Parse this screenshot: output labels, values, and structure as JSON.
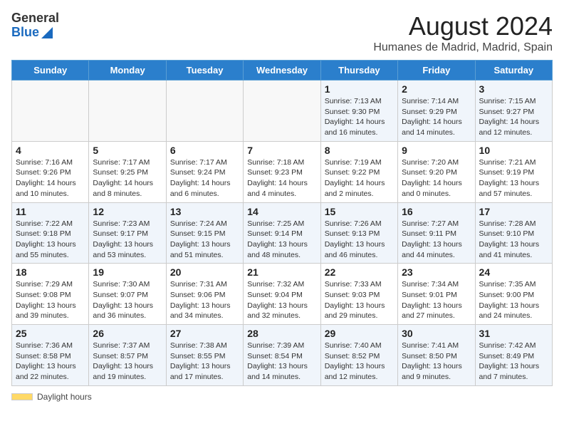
{
  "logo": {
    "general": "General",
    "blue": "Blue"
  },
  "title": "August 2024",
  "subtitle": "Humanes de Madrid, Madrid, Spain",
  "days_of_week": [
    "Sunday",
    "Monday",
    "Tuesday",
    "Wednesday",
    "Thursday",
    "Friday",
    "Saturday"
  ],
  "footer": {
    "label": "Daylight hours"
  },
  "weeks": [
    [
      {
        "day": "",
        "info": ""
      },
      {
        "day": "",
        "info": ""
      },
      {
        "day": "",
        "info": ""
      },
      {
        "day": "",
        "info": ""
      },
      {
        "day": "1",
        "info": "Sunrise: 7:13 AM\nSunset: 9:30 PM\nDaylight: 14 hours and 16 minutes."
      },
      {
        "day": "2",
        "info": "Sunrise: 7:14 AM\nSunset: 9:29 PM\nDaylight: 14 hours and 14 minutes."
      },
      {
        "day": "3",
        "info": "Sunrise: 7:15 AM\nSunset: 9:27 PM\nDaylight: 14 hours and 12 minutes."
      }
    ],
    [
      {
        "day": "4",
        "info": "Sunrise: 7:16 AM\nSunset: 9:26 PM\nDaylight: 14 hours and 10 minutes."
      },
      {
        "day": "5",
        "info": "Sunrise: 7:17 AM\nSunset: 9:25 PM\nDaylight: 14 hours and 8 minutes."
      },
      {
        "day": "6",
        "info": "Sunrise: 7:17 AM\nSunset: 9:24 PM\nDaylight: 14 hours and 6 minutes."
      },
      {
        "day": "7",
        "info": "Sunrise: 7:18 AM\nSunset: 9:23 PM\nDaylight: 14 hours and 4 minutes."
      },
      {
        "day": "8",
        "info": "Sunrise: 7:19 AM\nSunset: 9:22 PM\nDaylight: 14 hours and 2 minutes."
      },
      {
        "day": "9",
        "info": "Sunrise: 7:20 AM\nSunset: 9:20 PM\nDaylight: 14 hours and 0 minutes."
      },
      {
        "day": "10",
        "info": "Sunrise: 7:21 AM\nSunset: 9:19 PM\nDaylight: 13 hours and 57 minutes."
      }
    ],
    [
      {
        "day": "11",
        "info": "Sunrise: 7:22 AM\nSunset: 9:18 PM\nDaylight: 13 hours and 55 minutes."
      },
      {
        "day": "12",
        "info": "Sunrise: 7:23 AM\nSunset: 9:17 PM\nDaylight: 13 hours and 53 minutes."
      },
      {
        "day": "13",
        "info": "Sunrise: 7:24 AM\nSunset: 9:15 PM\nDaylight: 13 hours and 51 minutes."
      },
      {
        "day": "14",
        "info": "Sunrise: 7:25 AM\nSunset: 9:14 PM\nDaylight: 13 hours and 48 minutes."
      },
      {
        "day": "15",
        "info": "Sunrise: 7:26 AM\nSunset: 9:13 PM\nDaylight: 13 hours and 46 minutes."
      },
      {
        "day": "16",
        "info": "Sunrise: 7:27 AM\nSunset: 9:11 PM\nDaylight: 13 hours and 44 minutes."
      },
      {
        "day": "17",
        "info": "Sunrise: 7:28 AM\nSunset: 9:10 PM\nDaylight: 13 hours and 41 minutes."
      }
    ],
    [
      {
        "day": "18",
        "info": "Sunrise: 7:29 AM\nSunset: 9:08 PM\nDaylight: 13 hours and 39 minutes."
      },
      {
        "day": "19",
        "info": "Sunrise: 7:30 AM\nSunset: 9:07 PM\nDaylight: 13 hours and 36 minutes."
      },
      {
        "day": "20",
        "info": "Sunrise: 7:31 AM\nSunset: 9:06 PM\nDaylight: 13 hours and 34 minutes."
      },
      {
        "day": "21",
        "info": "Sunrise: 7:32 AM\nSunset: 9:04 PM\nDaylight: 13 hours and 32 minutes."
      },
      {
        "day": "22",
        "info": "Sunrise: 7:33 AM\nSunset: 9:03 PM\nDaylight: 13 hours and 29 minutes."
      },
      {
        "day": "23",
        "info": "Sunrise: 7:34 AM\nSunset: 9:01 PM\nDaylight: 13 hours and 27 minutes."
      },
      {
        "day": "24",
        "info": "Sunrise: 7:35 AM\nSunset: 9:00 PM\nDaylight: 13 hours and 24 minutes."
      }
    ],
    [
      {
        "day": "25",
        "info": "Sunrise: 7:36 AM\nSunset: 8:58 PM\nDaylight: 13 hours and 22 minutes."
      },
      {
        "day": "26",
        "info": "Sunrise: 7:37 AM\nSunset: 8:57 PM\nDaylight: 13 hours and 19 minutes."
      },
      {
        "day": "27",
        "info": "Sunrise: 7:38 AM\nSunset: 8:55 PM\nDaylight: 13 hours and 17 minutes."
      },
      {
        "day": "28",
        "info": "Sunrise: 7:39 AM\nSunset: 8:54 PM\nDaylight: 13 hours and 14 minutes."
      },
      {
        "day": "29",
        "info": "Sunrise: 7:40 AM\nSunset: 8:52 PM\nDaylight: 13 hours and 12 minutes."
      },
      {
        "day": "30",
        "info": "Sunrise: 7:41 AM\nSunset: 8:50 PM\nDaylight: 13 hours and 9 minutes."
      },
      {
        "day": "31",
        "info": "Sunrise: 7:42 AM\nSunset: 8:49 PM\nDaylight: 13 hours and 7 minutes."
      }
    ]
  ]
}
